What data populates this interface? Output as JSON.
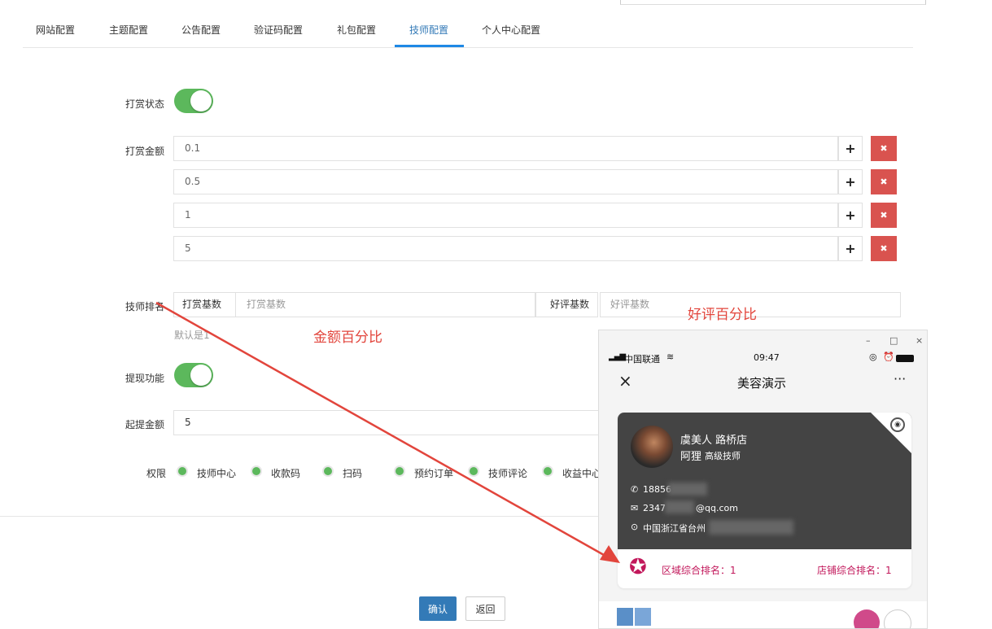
{
  "tabs": [
    {
      "label": "网站配置"
    },
    {
      "label": "主题配置"
    },
    {
      "label": "公告配置"
    },
    {
      "label": "验证码配置"
    },
    {
      "label": "礼包配置"
    },
    {
      "label": "技师配置"
    },
    {
      "label": "个人中心配置"
    }
  ],
  "active_tab": "技师配置",
  "tip_status": {
    "label": "打赏状态",
    "on": true
  },
  "tip_amount": {
    "label": "打赏金额",
    "values": [
      "0.1",
      "0.5",
      "1",
      "5"
    ],
    "add_icon": "plus-icon",
    "remove_icon": "close-icon"
  },
  "ranking": {
    "label": "技师排名",
    "tip_base_label": "打赏基数",
    "tip_base_placeholder": "打赏基数",
    "review_base_label": "好评基数",
    "review_base_placeholder": "好评基数",
    "hint": "默认是1"
  },
  "annotations": {
    "amount_percent": "金额百分比",
    "review_percent": "好评百分比",
    "arrow_color": "#e2453c"
  },
  "withdraw": {
    "label": "提现功能",
    "on": true
  },
  "min_withdraw": {
    "label": "起提金额",
    "value": "5"
  },
  "permissions": {
    "label": "权限",
    "items": [
      "技师中心",
      "收款码",
      "扫码",
      "预约订单",
      "技师评论",
      "收益中心"
    ]
  },
  "buttons": {
    "confirm": "确认",
    "back": "返回"
  },
  "phone": {
    "window_controls": [
      "–",
      "□",
      "×"
    ],
    "carrier": "中国联通",
    "time": "09:47",
    "title": "美容演示",
    "shop_name": "虞美人 路桥店",
    "tech_name": "阿狸",
    "tech_level": "高级技师",
    "phone_number": "18856",
    "email_prefix": "2347",
    "email_suffix": "@qq.com",
    "address": "中国浙江省台州",
    "region_rank": "区域综合排名：1",
    "store_rank": "店铺综合排名：1",
    "colors": {
      "accent": "#c2185b",
      "card": "#444444"
    }
  }
}
